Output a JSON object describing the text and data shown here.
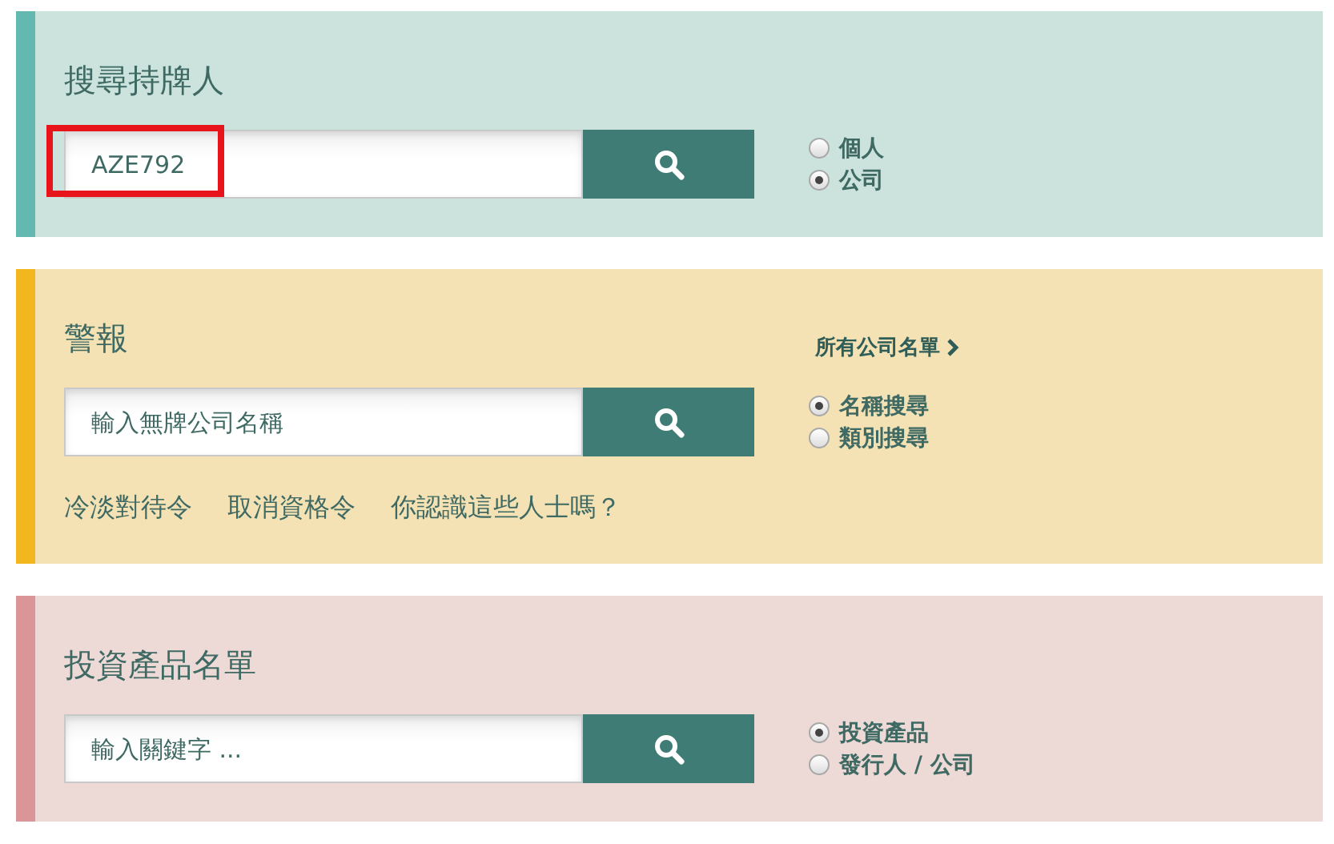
{
  "panels": [
    {
      "title": "搜尋持牌人",
      "color": "#63b9b0",
      "field": {
        "value": "AZE792",
        "highlighted": true
      },
      "options": [
        {
          "label": "個人",
          "selected": false
        },
        {
          "label": "公司",
          "selected": true
        }
      ]
    },
    {
      "title": "警報",
      "color": "#f2b71e",
      "link": "所有公司名單",
      "field": {
        "placeholder": "輸入無牌公司名稱"
      },
      "options": [
        {
          "label": "名稱搜尋",
          "selected": true
        },
        {
          "label": "類別搜尋",
          "selected": false
        }
      ],
      "links": [
        "冷淡對待令",
        "取消資格令",
        "你認識這些人士嗎？"
      ]
    },
    {
      "title": "投資產品名單",
      "color": "#d99597",
      "field": {
        "placeholder": "輸入關鍵字 ..."
      },
      "options": [
        {
          "label": "投資產品",
          "selected": true
        },
        {
          "label": "發行人 / 公司",
          "selected": false
        }
      ]
    }
  ]
}
